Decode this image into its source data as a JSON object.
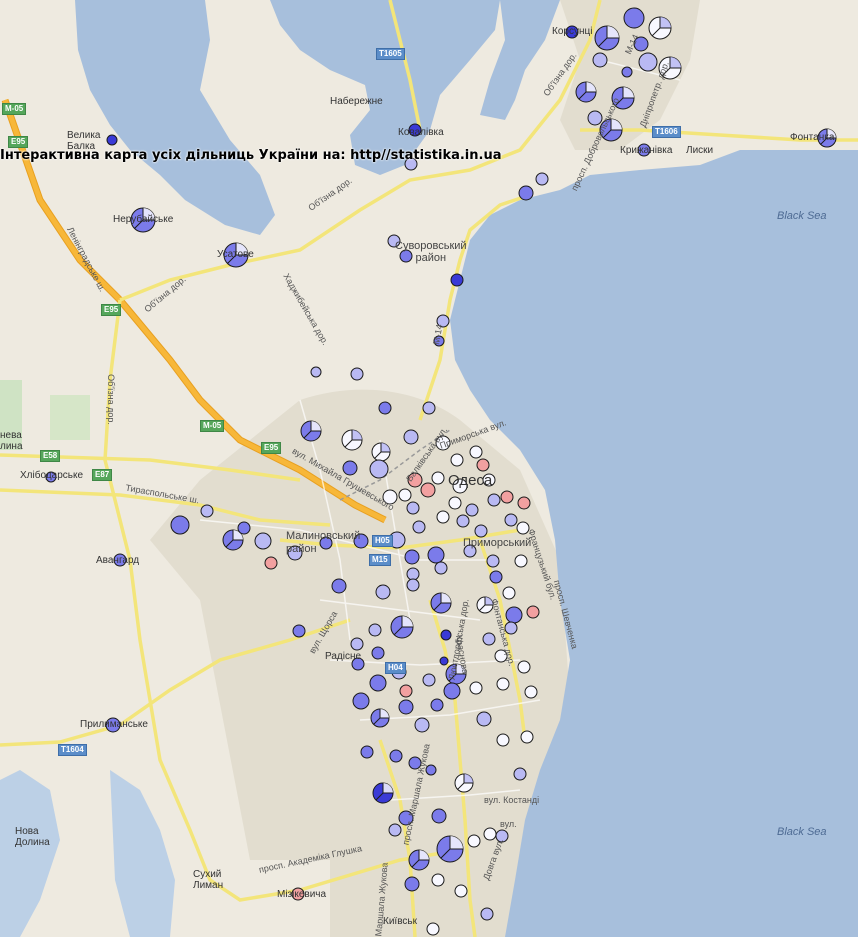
{
  "banner": "Інтерактивна карта усіх дільниць України на: http//statistika.in.ua",
  "colors": {
    "sea": "#a7bfdc",
    "land": "#eeeae0",
    "urban": "#e4dfd2",
    "highway": "#f7b739",
    "road": "#fff8b0",
    "station_dark": "#3a3ad6",
    "station_mid": "#7b7bea",
    "station_light": "#b9b9f3",
    "station_white": "#f8f8ff",
    "station_red": "#f2a0a0"
  },
  "places": [
    {
      "id": "korsuntsi",
      "text": "Корсунці"
    },
    {
      "id": "naberezhne",
      "text": "Набережне"
    },
    {
      "id": "velyka-balka",
      "text": "Велика\nБалка"
    },
    {
      "id": "kovalivka",
      "text": "Ковалівка"
    },
    {
      "id": "kryzhanivka",
      "text": "Крижанівка"
    },
    {
      "id": "lyski",
      "text": "Лиски"
    },
    {
      "id": "fontanka",
      "text": "Фонтанка"
    },
    {
      "id": "nerubaiske",
      "text": "Нерубайське"
    },
    {
      "id": "usatove",
      "text": "Усатове"
    },
    {
      "id": "suvorovskyi",
      "text": "Суворовський\nрайон"
    },
    {
      "id": "nova-dolyna-w",
      "text": "нева\nлина"
    },
    {
      "id": "khlibodarske",
      "text": "Хлібодарське"
    },
    {
      "id": "avanhard",
      "text": "Авангард"
    },
    {
      "id": "malynovskyi",
      "text": "Малиновський\nрайон"
    },
    {
      "id": "odesa",
      "text": "Одеса"
    },
    {
      "id": "prymorskyi",
      "text": "Приморський"
    },
    {
      "id": "radisne",
      "text": "Радісне"
    },
    {
      "id": "prylymanske",
      "text": "Прилиманське"
    },
    {
      "id": "nova-dolyna",
      "text": "Нова\nДолина"
    },
    {
      "id": "sukhyi-lyman",
      "text": "Сухий\nЛиман"
    },
    {
      "id": "mizikevycha",
      "text": "Мізікевича"
    },
    {
      "id": "kyivskyi",
      "text": "Київськ"
    }
  ],
  "sea_labels": [
    "Black Sea",
    "Black Sea"
  ],
  "streets": [
    {
      "id": "obyizna-1",
      "text": "Об'їзна дор."
    },
    {
      "id": "obyizna-2",
      "text": "Об'їзна дор."
    },
    {
      "id": "obyizna-3",
      "text": "Об'їзна дор."
    },
    {
      "id": "obyizna-4",
      "text": "Об'їзна дор."
    },
    {
      "id": "khadzhybeiska",
      "text": "Хаджибейська дор."
    },
    {
      "id": "leningradske",
      "text": "Ленінградське ш."
    },
    {
      "id": "tyraspolske",
      "text": "Тираспольське ш."
    },
    {
      "id": "dobrovolskoho",
      "text": "просп. Добровольського"
    },
    {
      "id": "dnipropetrovska",
      "text": "Дніпропетр. дор."
    },
    {
      "id": "mykhaila-hrushevskoho",
      "text": "вул. Михайла Грушевського"
    },
    {
      "id": "balkivska",
      "text": "Балківська вул."
    },
    {
      "id": "prymorska",
      "text": "Приморська вул."
    },
    {
      "id": "shchorsa",
      "text": "вул. Щорса"
    },
    {
      "id": "lyustdorfska",
      "text": "Люстдорфська дор."
    },
    {
      "id": "krasnova",
      "text": "Краснова"
    },
    {
      "id": "fontanska",
      "text": "Фонтанська дор."
    },
    {
      "id": "frantsuzkyi",
      "text": "Французький бул."
    },
    {
      "id": "shevchenka",
      "text": "просп. Шевченка"
    },
    {
      "id": "kostandi",
      "text": "вул. Костанді"
    },
    {
      "id": "marshala-zhukova-1",
      "text": "просп. Маршала Жукова"
    },
    {
      "id": "marshala-zhukova-2",
      "text": "Маршала Жукова"
    },
    {
      "id": "hlushka",
      "text": "просп. Академіка Глушка"
    },
    {
      "id": "dovha",
      "text": "Довга вул."
    },
    {
      "id": "vilyamsa",
      "text": "вул."
    },
    {
      "id": "m14",
      "text": "M-14"
    },
    {
      "id": "h14",
      "text": "M-14"
    }
  ],
  "highway_shields": [
    {
      "id": "t1605",
      "text": "T1605",
      "color": "blue"
    },
    {
      "id": "t1606",
      "text": "T1606",
      "color": "blue"
    },
    {
      "id": "m05-n",
      "text": "M-05",
      "color": "green"
    },
    {
      "id": "e95-n",
      "text": "E95",
      "color": "green"
    },
    {
      "id": "e95-m",
      "text": "E95",
      "color": "green"
    },
    {
      "id": "m05-s",
      "text": "M-05",
      "color": "green"
    },
    {
      "id": "e95-s",
      "text": "E95",
      "color": "green"
    },
    {
      "id": "e58",
      "text": "E58",
      "color": "green"
    },
    {
      "id": "e87",
      "text": "E87",
      "color": "green"
    },
    {
      "id": "h05",
      "text": "H05",
      "color": "blue"
    },
    {
      "id": "m15",
      "text": "M15",
      "color": "blue"
    },
    {
      "id": "h04",
      "text": "H04",
      "color": "blue"
    },
    {
      "id": "t1604",
      "text": "T1604",
      "color": "blue"
    }
  ]
}
